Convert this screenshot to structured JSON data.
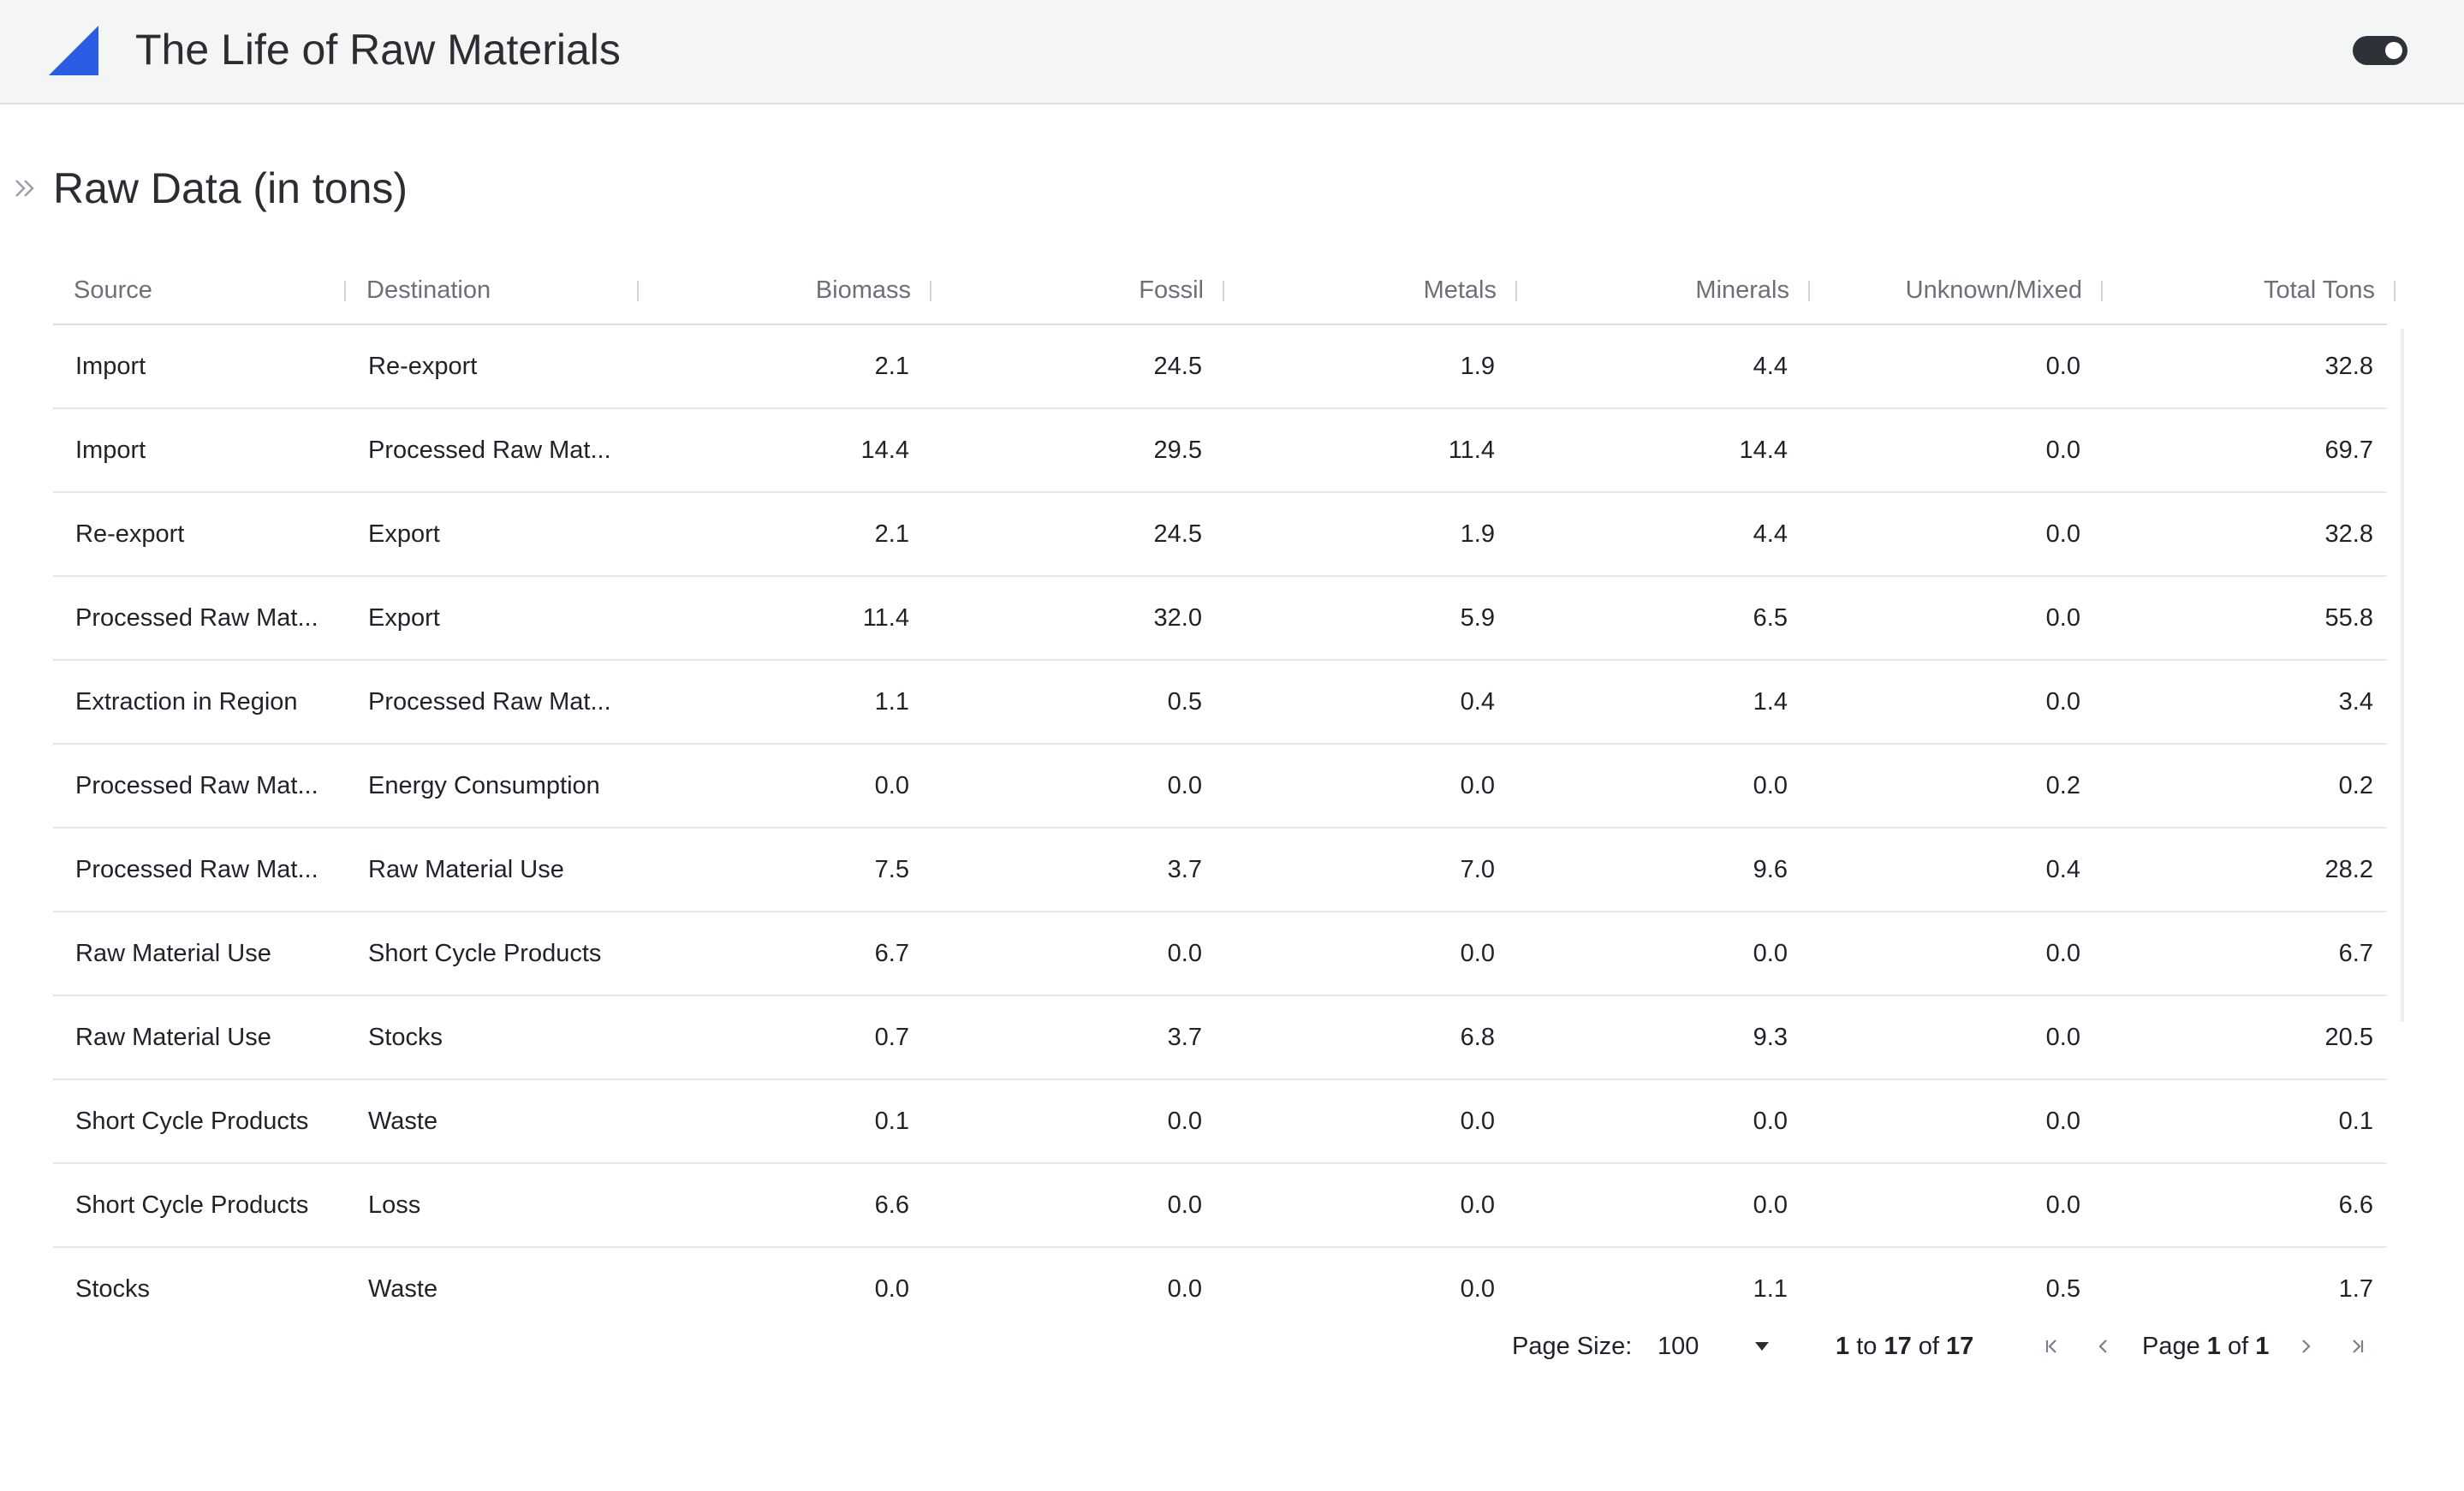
{
  "header": {
    "app_title": "The Life of Raw Materials",
    "accent_color": "#2b5ce6",
    "logo_icon": "triangle-logo",
    "theme_toggle_icon": "toggle-switch"
  },
  "page": {
    "title": "Raw Data (in tons)",
    "sidebar_toggle_icon": "double-chevron-right"
  },
  "grid": {
    "columns": [
      "Source",
      "Destination",
      "Biomass",
      "Fossil",
      "Metals",
      "Minerals",
      "Unknown/Mixed",
      "Total Tons"
    ],
    "rows": [
      [
        "Import",
        "Re-export",
        "2.1",
        "24.5",
        "1.9",
        "4.4",
        "0.0",
        "32.8"
      ],
      [
        "Import",
        "Processed Raw Mat...",
        "14.4",
        "29.5",
        "11.4",
        "14.4",
        "0.0",
        "69.7"
      ],
      [
        "Re-export",
        "Export",
        "2.1",
        "24.5",
        "1.9",
        "4.4",
        "0.0",
        "32.8"
      ],
      [
        "Processed Raw Mat...",
        "Export",
        "11.4",
        "32.0",
        "5.9",
        "6.5",
        "0.0",
        "55.8"
      ],
      [
        "Extraction in Region",
        "Processed Raw Mat...",
        "1.1",
        "0.5",
        "0.4",
        "1.4",
        "0.0",
        "3.4"
      ],
      [
        "Processed Raw Mat...",
        "Energy Consumption",
        "0.0",
        "0.0",
        "0.0",
        "0.0",
        "0.2",
        "0.2"
      ],
      [
        "Processed Raw Mat...",
        "Raw Material Use",
        "7.5",
        "3.7",
        "7.0",
        "9.6",
        "0.4",
        "28.2"
      ],
      [
        "Raw Material Use",
        "Short Cycle Products",
        "6.7",
        "0.0",
        "0.0",
        "0.0",
        "0.0",
        "6.7"
      ],
      [
        "Raw Material Use",
        "Stocks",
        "0.7",
        "3.7",
        "6.8",
        "9.3",
        "0.0",
        "20.5"
      ],
      [
        "Short Cycle Products",
        "Waste",
        "0.1",
        "0.0",
        "0.0",
        "0.0",
        "0.0",
        "0.1"
      ],
      [
        "Short Cycle Products",
        "Loss",
        "6.6",
        "0.0",
        "0.0",
        "0.0",
        "0.0",
        "6.6"
      ],
      [
        "Stocks",
        "Waste",
        "0.0",
        "0.0",
        "0.0",
        "1.1",
        "0.5",
        "1.7"
      ]
    ]
  },
  "pagination": {
    "page_size_label": "Page Size:",
    "page_size_value": "100",
    "range_from": "1",
    "range_to_word": "to",
    "range_to": "17",
    "range_of_word": "of",
    "range_total": "17",
    "page_word": "Page",
    "page_current": "1",
    "page_of_word": "of",
    "page_total": "1",
    "first_icon": "first-page-icon",
    "prev_icon": "previous-page-icon",
    "next_icon": "next-page-icon",
    "last_icon": "last-page-icon"
  }
}
